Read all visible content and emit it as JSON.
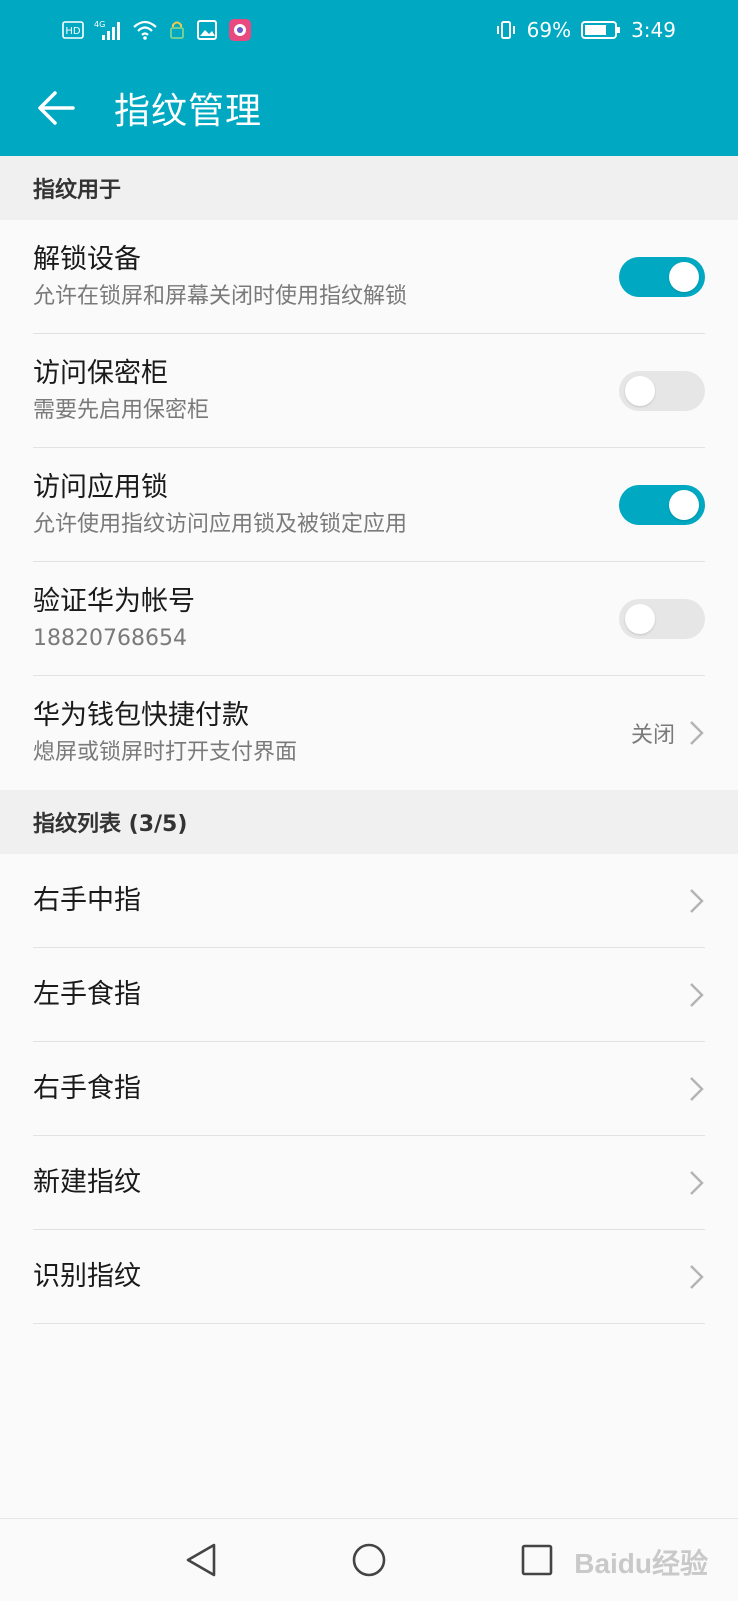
{
  "status_bar": {
    "left_icons": [
      "hd-icon",
      "signal-4g-icon",
      "wifi-icon",
      "lock-icon",
      "image-icon",
      "app-badge-icon"
    ],
    "hd": "HD",
    "network": "4G",
    "battery_percent": "69%",
    "time": "3:49"
  },
  "app_bar": {
    "title": "指纹管理"
  },
  "sections": {
    "usage": {
      "header": "指纹用于",
      "items": [
        {
          "title": "解锁设备",
          "subtitle": "允许在锁屏和屏幕关闭时使用指纹解锁",
          "toggle": true
        },
        {
          "title": "访问保密柜",
          "subtitle": "需要先启用保密柜",
          "toggle": false
        },
        {
          "title": "访问应用锁",
          "subtitle": "允许使用指纹访问应用锁及被锁定应用",
          "toggle": true
        },
        {
          "title": "验证华为帐号",
          "subtitle": "18820768654",
          "toggle": false
        },
        {
          "title": "华为钱包快捷付款",
          "subtitle": "熄屏或锁屏时打开支付界面",
          "value": "关闭"
        }
      ]
    },
    "fingerprints": {
      "header": "指纹列表 (3/5)",
      "items": [
        "右手中指",
        "左手食指",
        "右手食指",
        "新建指纹",
        "识别指纹"
      ]
    }
  },
  "nav_bar": {
    "buttons": [
      "back-triangle-icon",
      "home-circle-icon",
      "recents-square-icon"
    ]
  },
  "watermark": "Baidu经验",
  "colors": {
    "accent": "#00a8c2",
    "toggle_off": "#e6e6e6",
    "background": "#fafafa"
  }
}
